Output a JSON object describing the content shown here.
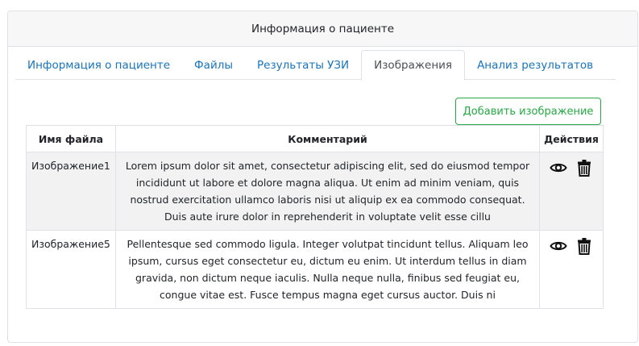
{
  "card": {
    "title": "Информация о пациенте"
  },
  "tabs": [
    {
      "label": "Информация о пациенте",
      "active": false
    },
    {
      "label": "Файлы",
      "active": false
    },
    {
      "label": "Результаты УЗИ",
      "active": false
    },
    {
      "label": "Изображения",
      "active": true
    },
    {
      "label": "Анализ результатов",
      "active": false
    }
  ],
  "toolbar": {
    "add_image_label": "Добавить изображение"
  },
  "table": {
    "headers": [
      "Имя файла",
      "Комментарий",
      "Действия"
    ],
    "rows": [
      {
        "file_name": "Изображение1",
        "comment": "Lorem ipsum dolor sit amet, consectetur adipiscing elit, sed do eiusmod tempor incididunt ut labore et dolore magna aliqua. Ut enim ad minim veniam, quis nostrud exercitation ullamco laboris nisi ut aliquip ex ea commodo consequat. Duis aute irure dolor in reprehenderit in voluptate velit esse cillu",
        "actions": [
          "eye-icon",
          "trash-icon"
        ]
      },
      {
        "file_name": "Изображение5",
        "comment": "Pellentesque sed commodo ligula. Integer volutpat tincidunt tellus. Aliquam leo ipsum, cursus eget consectetur eu, dictum eu enim. Ut interdum tellus in diam gravida, non dictum neque iaculis. Nulla neque nulla, finibus sed feugiat eu, congue vitae est. Fusce tempus magna eget cursus auctor. Duis ni",
        "actions": [
          "eye-icon",
          "trash-icon"
        ]
      }
    ]
  },
  "colors": {
    "link": "#1a73b8",
    "success": "#28a745",
    "border": "#dee2e6",
    "header_bg": "#f7f7f7",
    "stripe": "#f2f2f2"
  }
}
